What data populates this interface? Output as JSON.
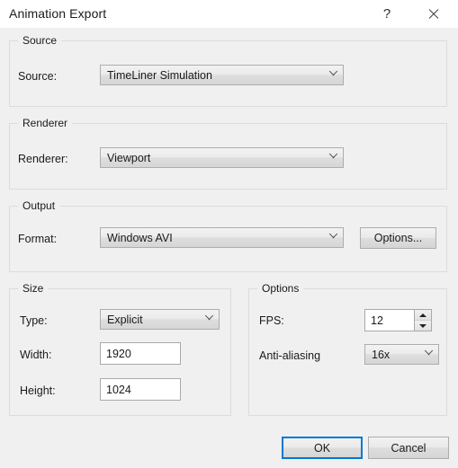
{
  "window": {
    "title": "Animation Export",
    "help_icon": "question-mark-icon",
    "close_icon": "close-icon"
  },
  "source_group": {
    "title": "Source",
    "source_label": "Source:",
    "source_value": "TimeLiner Simulation"
  },
  "renderer_group": {
    "title": "Renderer",
    "renderer_label": "Renderer:",
    "renderer_value": "Viewport"
  },
  "output_group": {
    "title": "Output",
    "format_label": "Format:",
    "format_value": "Windows AVI",
    "options_button": "Options..."
  },
  "size_group": {
    "title": "Size",
    "type_label": "Type:",
    "type_value": "Explicit",
    "width_label": "Width:",
    "width_value": "1920",
    "height_label": "Height:",
    "height_value": "1024"
  },
  "options_group": {
    "title": "Options",
    "fps_label": "FPS:",
    "fps_value": "12",
    "antialiasing_label": "Anti-aliasing",
    "antialiasing_value": "16x"
  },
  "footer": {
    "ok_label": "OK",
    "cancel_label": "Cancel"
  },
  "colors": {
    "dialog_background": "#f0f0f0",
    "titlebar_background": "#ffffff",
    "accent_focus": "#0078d7",
    "group_border": "#dcdcdc",
    "control_border": "#adadad",
    "text": "#1a1a1a"
  }
}
